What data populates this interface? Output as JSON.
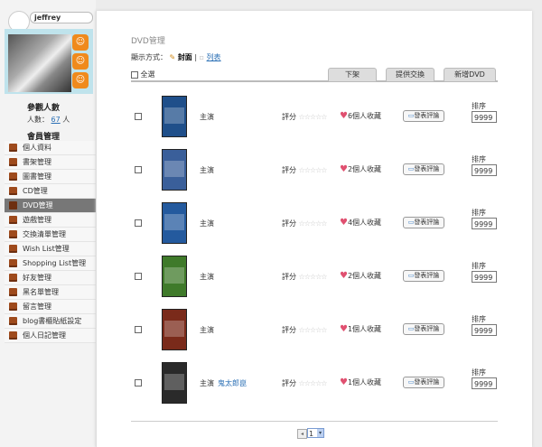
{
  "user": {
    "name": "jeffrey"
  },
  "visitors": {
    "title": "參觀人數",
    "label": "人數：",
    "count": "67",
    "unit": "人"
  },
  "management": {
    "title": "會員管理"
  },
  "menu": [
    {
      "label": "個人資料"
    },
    {
      "label": "書架管理"
    },
    {
      "label": "圖書管理"
    },
    {
      "label": "CD管理"
    },
    {
      "label": "DVD管理",
      "active": true
    },
    {
      "label": "遊戲管理"
    },
    {
      "label": "交換清單管理"
    },
    {
      "label": "Wish List管理"
    },
    {
      "label": "Shopping List管理"
    },
    {
      "label": "好友管理"
    },
    {
      "label": "黑名單管理"
    },
    {
      "label": "留言管理"
    },
    {
      "label": "blog書櫃貼紙設定"
    },
    {
      "label": "個人日記管理"
    }
  ],
  "main": {
    "title": "DVD管理",
    "display_label": "顯示方式：",
    "cover_label": "封面",
    "separator": "|",
    "list_label": "列表",
    "select_all": "全選",
    "tabs": [
      "下架",
      "提供交換",
      "新增DVD"
    ],
    "columns": {
      "actor": "主演",
      "rating": "評分",
      "stars": "☆☆☆☆☆",
      "comment": "發表評論",
      "sort": "排序"
    },
    "items": [
      {
        "actor_name": "",
        "fav": "6個人收藏",
        "sort": "9999",
        "cover_color": "#1f4f8a"
      },
      {
        "actor_name": "",
        "fav": "2個人收藏",
        "sort": "9999",
        "cover_color": "#3a5f9a"
      },
      {
        "actor_name": "",
        "fav": "4個人收藏",
        "sort": "9999",
        "cover_color": "#245a9e"
      },
      {
        "actor_name": "",
        "fav": "2個人收藏",
        "sort": "9999",
        "cover_color": "#3f7a2a"
      },
      {
        "actor_name": "",
        "fav": "1個人收藏",
        "sort": "9999",
        "cover_color": "#7a2a1a"
      },
      {
        "actor_name": "鬼太郎崑",
        "fav": "1個人收藏",
        "sort": "9999",
        "cover_color": "#2a2a2a"
      }
    ],
    "pager": {
      "page": "1"
    }
  }
}
